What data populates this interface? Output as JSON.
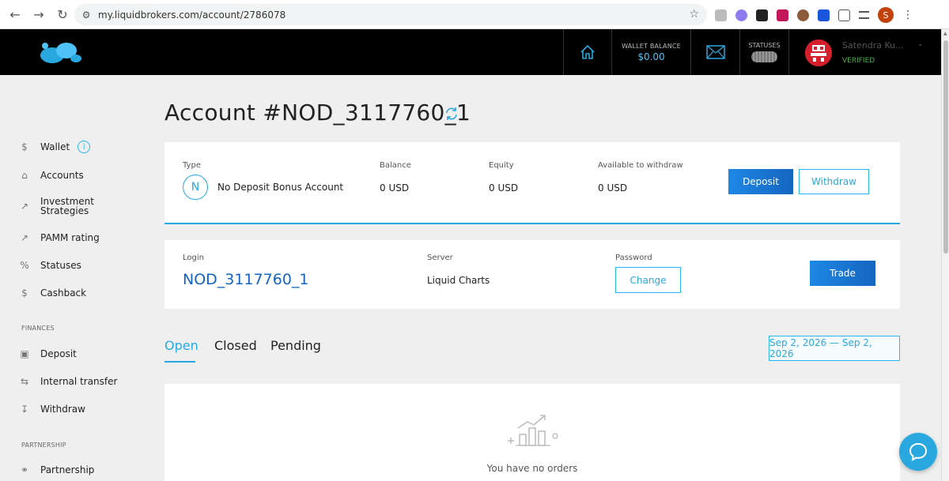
{
  "browser": {
    "url": "my.liquidbrokers.com/account/2786078",
    "profile_initial": "S"
  },
  "header": {
    "wallet_label": "WALLET BALANCE",
    "wallet_value": "$0.00",
    "statuses_label": "STATUSES",
    "user_name": "Satendra Ku...",
    "user_status": "VERIFIED",
    "accent_color": "#4fc3f7"
  },
  "sidebar": {
    "items": [
      {
        "label": "Wallet",
        "icon": "dollar-icon"
      },
      {
        "label": "Accounts",
        "icon": "home-icon"
      },
      {
        "label": "Investment Strategies",
        "icon": "chart-line-icon"
      },
      {
        "label": "PAMM rating",
        "icon": "chart-line-icon"
      },
      {
        "label": "Statuses",
        "icon": "percent-icon"
      },
      {
        "label": "Cashback",
        "icon": "dollar-icon"
      }
    ],
    "finances_title": "FINANCES",
    "finances": [
      {
        "label": "Deposit",
        "icon": "wallet-icon"
      },
      {
        "label": "Internal transfer",
        "icon": "transfer-icon"
      },
      {
        "label": "Withdraw",
        "icon": "withdraw-icon"
      }
    ],
    "partnership_title": "PARTNERSHIP",
    "partnership": [
      {
        "label": "Partnership",
        "icon": "handshake-icon"
      }
    ]
  },
  "main": {
    "title": "Account #NOD_3117760_1",
    "account": {
      "type_label": "Type",
      "type_badge": "N",
      "type_value": "No Deposit Bonus Account",
      "balance_label": "Balance",
      "balance_value": "0 USD",
      "equity_label": "Equity",
      "equity_value": "0 USD",
      "withdraw_label": "Available to withdraw",
      "withdraw_value": "0 USD",
      "deposit_button": "Deposit",
      "withdraw_button": "Withdraw"
    },
    "login": {
      "login_label": "Login",
      "login_value": "NOD_3117760_1",
      "server_label": "Server",
      "server_value": "Liquid Charts",
      "password_label": "Password",
      "change_button": "Change",
      "trade_button": "Trade"
    },
    "tabs": [
      {
        "label": "Open",
        "active": true
      },
      {
        "label": "Closed",
        "active": false
      },
      {
        "label": "Pending",
        "active": false
      }
    ],
    "date_range": "Sep 2, 2026 — Sep 2, 2026",
    "empty_message": "You have no orders"
  }
}
